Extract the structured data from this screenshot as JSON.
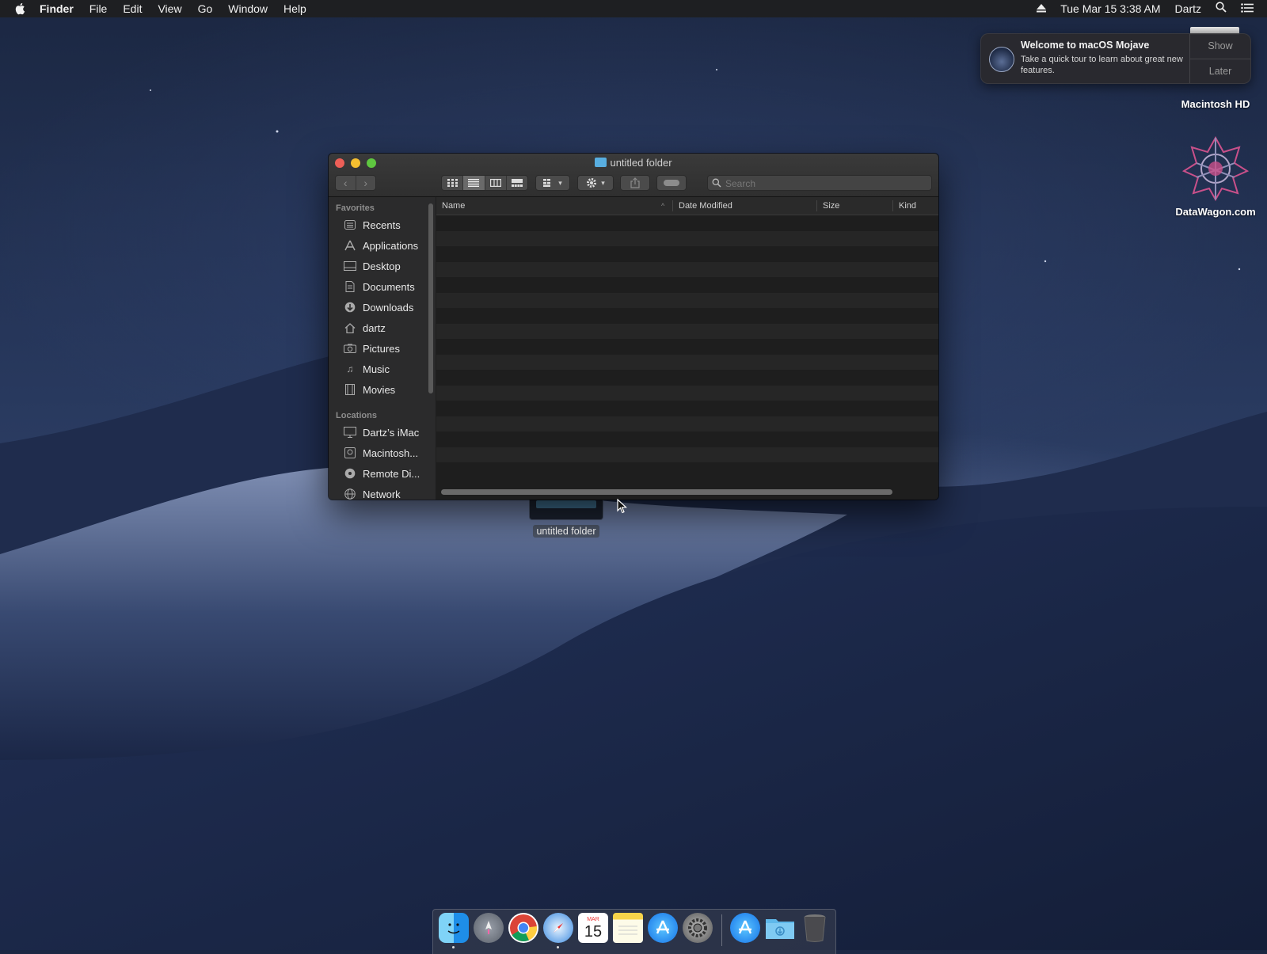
{
  "menubar": {
    "app_name": "Finder",
    "menus": [
      "File",
      "Edit",
      "View",
      "Go",
      "Window",
      "Help"
    ],
    "clock": "Tue Mar 15  3:38 AM",
    "user": "Dartz"
  },
  "notification": {
    "title": "Welcome to macOS Mojave",
    "body": "Take a quick tour to learn about great new features.",
    "show_label": "Show",
    "later_label": "Later"
  },
  "desktop": {
    "drive_label": "Macintosh HD",
    "datawagon_label": "DataWagon.com",
    "folder_label": "untitled folder"
  },
  "window": {
    "title": "untitled folder",
    "search_placeholder": "Search",
    "columns": [
      "Name",
      "Date Modified",
      "Size",
      "Kind"
    ],
    "sidebar": {
      "favorites_header": "Favorites",
      "favorites": [
        {
          "label": "Recents",
          "icon": "recents-icon"
        },
        {
          "label": "Applications",
          "icon": "applications-icon"
        },
        {
          "label": "Desktop",
          "icon": "desktop-icon"
        },
        {
          "label": "Documents",
          "icon": "documents-icon"
        },
        {
          "label": "Downloads",
          "icon": "downloads-icon"
        },
        {
          "label": "dartz",
          "icon": "home-icon"
        },
        {
          "label": "Pictures",
          "icon": "pictures-icon"
        },
        {
          "label": "Music",
          "icon": "music-icon"
        },
        {
          "label": "Movies",
          "icon": "movies-icon"
        }
      ],
      "locations_header": "Locations",
      "locations": [
        {
          "label": "Dartz’s iMac",
          "icon": "imac-icon"
        },
        {
          "label": "Macintosh...",
          "icon": "disk-icon"
        },
        {
          "label": "Remote Di...",
          "icon": "remote-disc-icon"
        },
        {
          "label": "Network",
          "icon": "network-icon"
        }
      ]
    }
  },
  "colors": {
    "accent": "#58aee0",
    "close": "#ed5f57",
    "minimize": "#f5bf30",
    "zoom": "#5fc740"
  }
}
